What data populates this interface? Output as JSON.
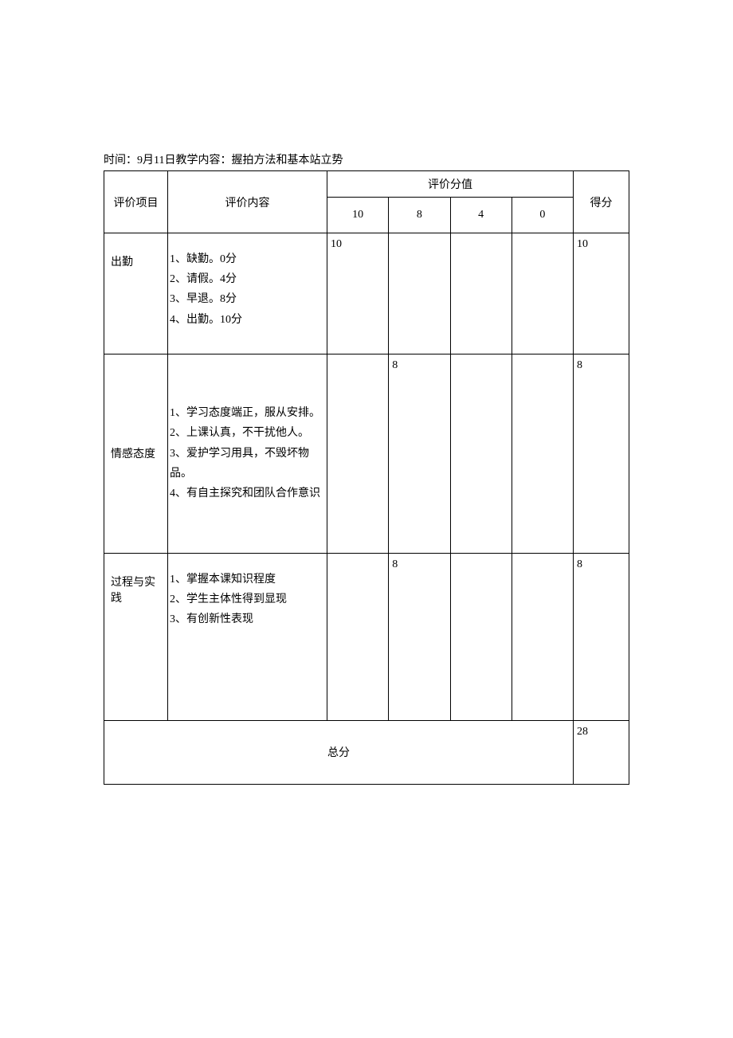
{
  "header_text": "时间：9月11日教学内容：握拍方法和基本站立势",
  "columns": {
    "item": "评价项目",
    "content": "评价内容",
    "score_header": "评价分值",
    "final": "得分",
    "score_levels": [
      "10",
      "8",
      "4",
      "0"
    ]
  },
  "rows": [
    {
      "item": "出勤",
      "content_lines": [
        "1、缺勤。0分",
        "2、请假。4分",
        "3、早退。8分",
        "4、出勤。10分"
      ],
      "scores": [
        "10",
        "",
        "",
        ""
      ],
      "final": "10"
    },
    {
      "item": "情感态度",
      "content_lines": [
        "1、学习态度端正，服从安排。",
        "2、上课认真，不干扰他人。",
        "3、爱护学习用具，不毁坏物品。",
        "4、有自主探究和团队合作意识"
      ],
      "scores": [
        "",
        "8",
        "",
        ""
      ],
      "final": "8"
    },
    {
      "item": "过程与实践",
      "content_lines": [
        "1、掌握本课知识程度",
        "2、学生主体性得到显现",
        "3、有创新性表现"
      ],
      "scores": [
        "",
        "8",
        "",
        ""
      ],
      "final": "8"
    }
  ],
  "total": {
    "label": "总分",
    "value": "28"
  }
}
